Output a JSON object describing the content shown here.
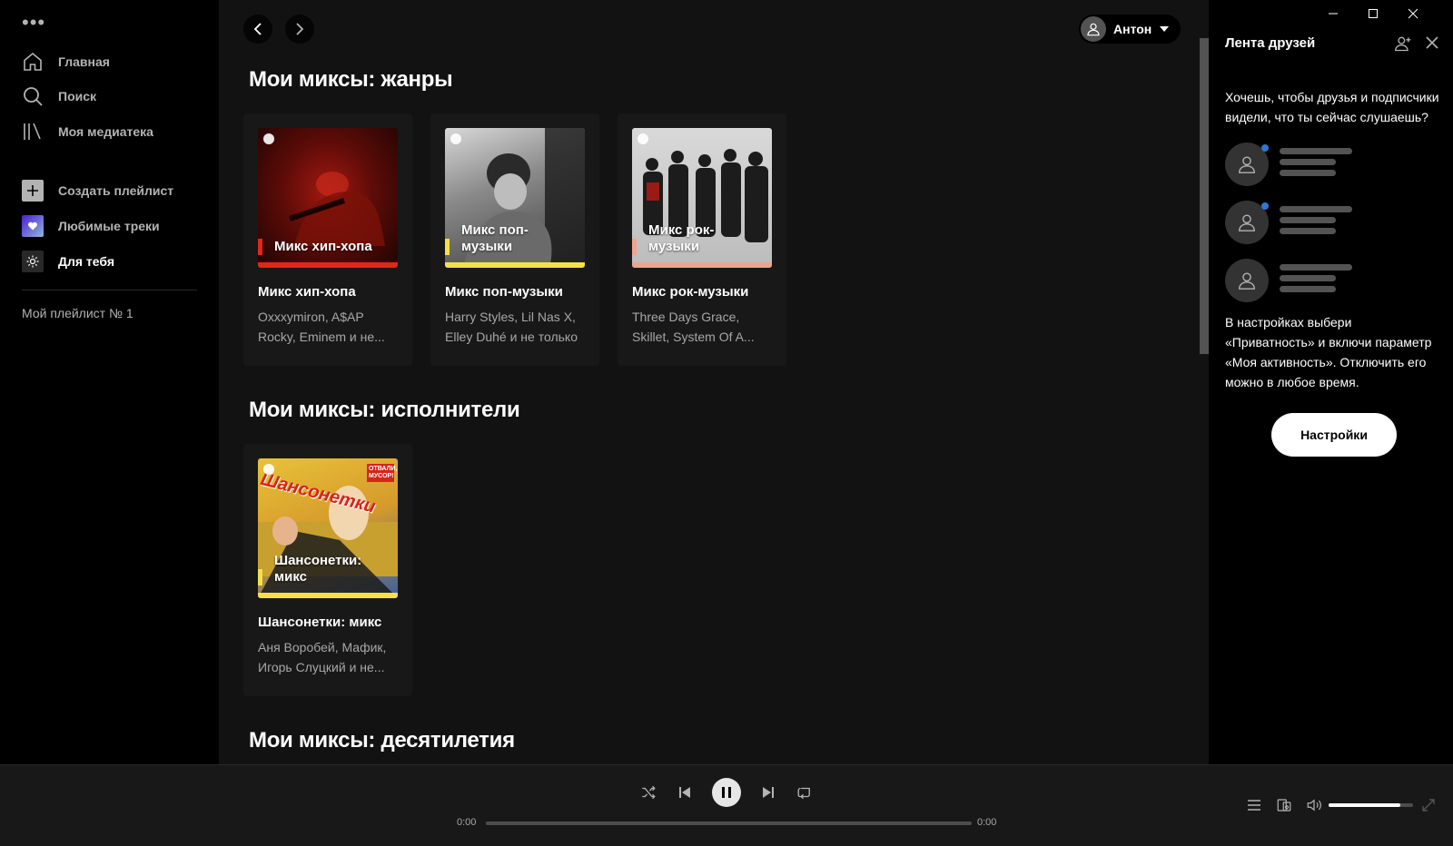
{
  "sidebar": {
    "menu_icon": "more-dots-icon",
    "nav": [
      {
        "label": "Главная",
        "icon": "home-icon"
      },
      {
        "label": "Поиск",
        "icon": "search-icon"
      },
      {
        "label": "Моя медиатека",
        "icon": "library-icon"
      }
    ],
    "actions": [
      {
        "label": "Создать плейлист",
        "icon": "plus-icon"
      },
      {
        "label": "Любимые треки",
        "icon": "heart-icon"
      },
      {
        "label": "Для тебя",
        "icon": "sun-icon"
      }
    ],
    "playlists": [
      "Мой плейлист № 1"
    ]
  },
  "header": {
    "user_name": "Антон"
  },
  "sections": [
    {
      "title": "Мои миксы: жанры",
      "cards": [
        {
          "cover_text": "Микс хип-хопа",
          "title": "Микс хип-хопа",
          "subtitle": "Oxxxymiron, A$AP Rocky, Eminem и не...",
          "accent": "#e22718"
        },
        {
          "cover_text": "Микс поп-музыки",
          "title": "Микс поп-музыки",
          "subtitle": "Harry Styles, Lil Nas X, Elley Duhé и не только",
          "accent": "#f5e04a"
        },
        {
          "cover_text": "Микс рок-музыки",
          "title": "Микс рок-музыки",
          "subtitle": "Three Days Grace, Skillet, System Of A...",
          "accent": "#f0a38c"
        }
      ]
    },
    {
      "title": "Мои миксы: исполнители",
      "cards": [
        {
          "cover_text": "Шансонетки: микс",
          "title": "Шансонетки: микс",
          "subtitle": "Аня Воробей, Мафик, Игорь Слуцкий и не...",
          "accent": "#f5e04a",
          "cover_lettering": "Шансонетки",
          "cover_sticker": "ОТВАЛИ, МУСОР!"
        }
      ]
    },
    {
      "title": "Мои миксы: десятилетия",
      "cards": []
    }
  ],
  "friends": {
    "title": "Лента друзей",
    "question": "Хочешь, чтобы друзья и подписчики видели, что ты сейчас слушаешь?",
    "info": "В настройках выбери «Приватность» и включи параметр «Моя активность». Отключить его можно в любое время.",
    "settings_label": "Настройки"
  },
  "player": {
    "time_elapsed": "0:00",
    "time_total": "0:00",
    "progress": 0,
    "volume": 0.85
  }
}
